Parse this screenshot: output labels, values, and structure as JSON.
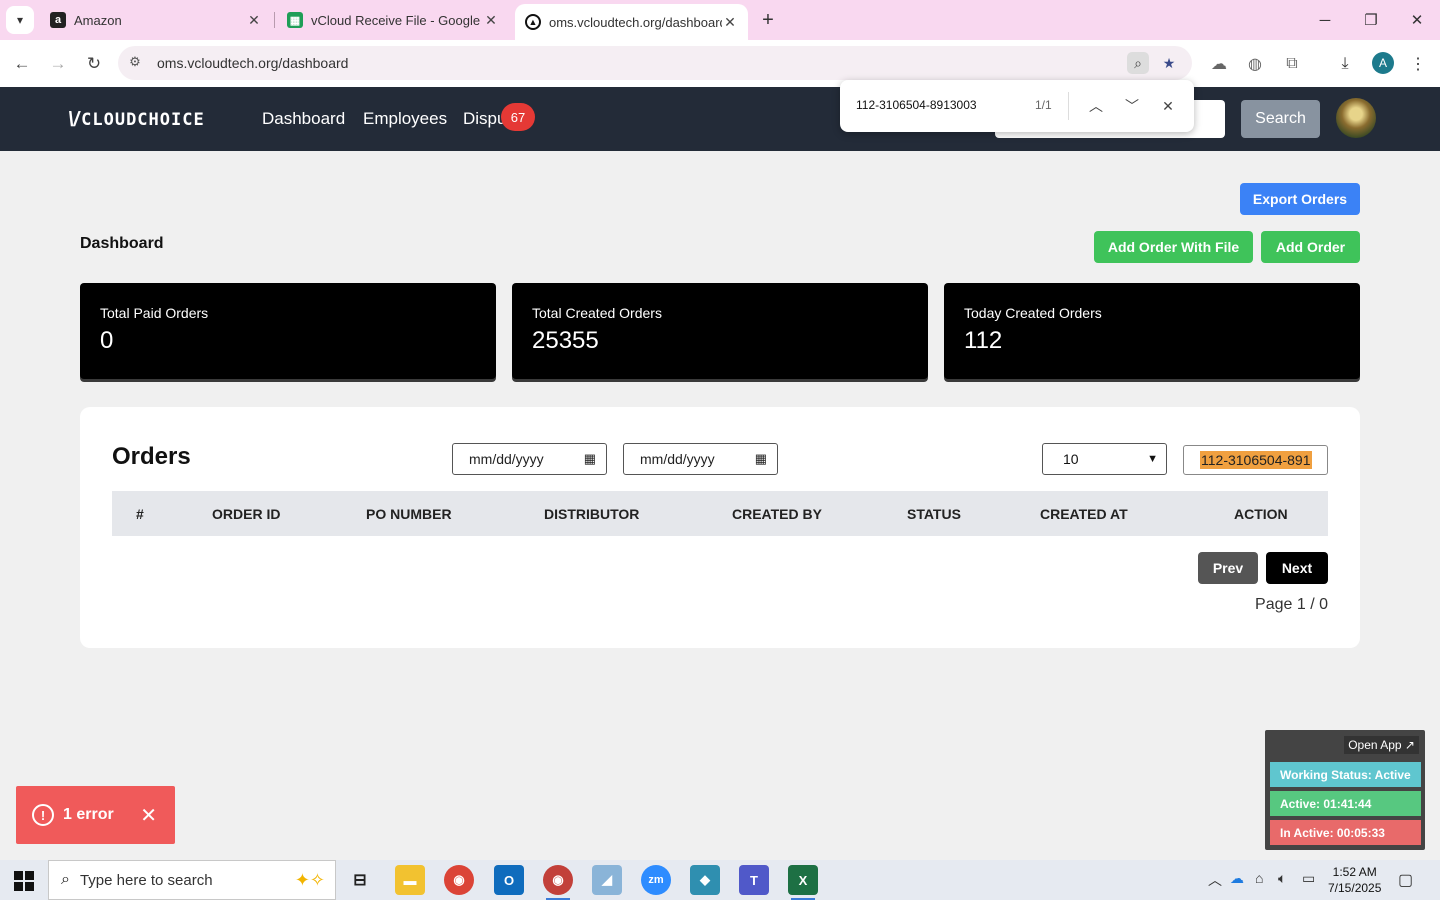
{
  "browser": {
    "tabs": [
      {
        "title": "Amazon",
        "favicon": "amazon-icon"
      },
      {
        "title": "vCloud Receive File - Google Sh",
        "favicon": "google-sheets-icon"
      },
      {
        "title": "oms.vcloudtech.org/dashboard",
        "favicon": "site-icon"
      }
    ],
    "url": "oms.vcloudtech.org/dashboard",
    "profile_initial": "A",
    "find": {
      "query": "112-3106504-8913003",
      "count": "1/1"
    }
  },
  "app": {
    "logo": "CLOUDCHOICE",
    "nav": [
      "Dashboard",
      "Employees",
      "Dispu"
    ],
    "disputes_badge": "67",
    "search_button": "Search"
  },
  "actions": {
    "export": "Export Orders",
    "add_with_file": "Add Order With File",
    "add": "Add Order"
  },
  "page_title": "Dashboard",
  "stats": [
    {
      "label": "Total Paid Orders",
      "value": "0"
    },
    {
      "label": "Total Created Orders",
      "value": "25355"
    },
    {
      "label": "Today Created Orders",
      "value": "112"
    }
  ],
  "orders": {
    "title": "Orders",
    "date_from_placeholder": "mm/dd/yyyy",
    "date_to_placeholder": "mm/dd/yyyy",
    "page_size": "10",
    "search_value": "112-3106504-891",
    "columns": [
      "#",
      "ORDER ID",
      "PO NUMBER",
      "DISTRIBUTOR",
      "CREATED BY",
      "STATUS",
      "CREATED AT",
      "ACTION"
    ],
    "prev": "Prev",
    "next": "Next",
    "page_info": "Page 1 / 0"
  },
  "toast": {
    "message": "1 error"
  },
  "tracker": {
    "open_app": "Open App ↗",
    "status": "Working Status: Active",
    "active": "Active: 01:41:44",
    "inactive": "In Active: 00:05:33"
  },
  "taskbar": {
    "search_placeholder": "Type here to search",
    "time": "1:52 AM",
    "date": "7/15/2025"
  },
  "colors": {
    "header_bg": "#232b38",
    "export_blue": "#3b82f6",
    "add_green": "#3fc35a",
    "toast_red": "#f05a5a",
    "status_teal": "#5fc6cf",
    "active_green": "#57c880",
    "inactive_red": "#e86a6a"
  }
}
